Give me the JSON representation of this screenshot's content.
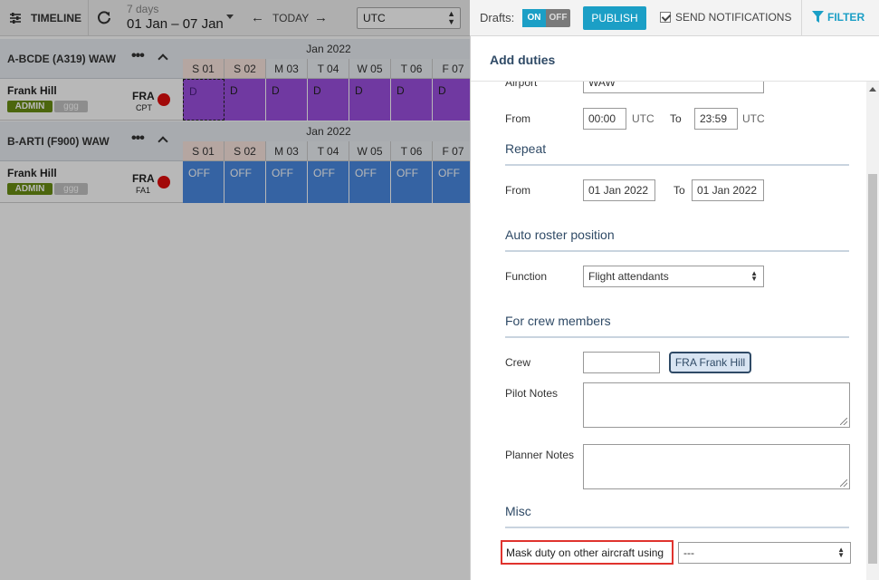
{
  "topbar": {
    "timeline_label": "TIMELINE",
    "range_small": "7 days",
    "range_big": "01 Jan – 07 Jan",
    "today_label": "TODAY",
    "timezone": "UTC",
    "drafts_label": "Drafts:",
    "toggle_on": "ON",
    "toggle_off": "OFF",
    "publish_label": "PUBLISH",
    "notify_label": "SEND NOTIFICATIONS",
    "filter_label": "FILTER"
  },
  "timeline": {
    "month_label": "Jan 2022",
    "days": [
      "S 01",
      "S 02",
      "M 03",
      "T 04",
      "W 05",
      "T 06",
      "F 07"
    ],
    "aircraft": [
      {
        "name": "A-BCDE (A319) WAW",
        "crew_name": "Frank Hill",
        "role_badge": "ADMIN",
        "tag": "ggg",
        "base": "FRA",
        "position": "CPT",
        "duties": [
          "D",
          "D",
          "D",
          "D",
          "D",
          "D",
          "D"
        ]
      },
      {
        "name": "B-ARTI (F900) WAW",
        "crew_name": "Frank Hill",
        "role_badge": "ADMIN",
        "tag": "ggg",
        "base": "FRA",
        "position": "FA1",
        "duties": [
          "OFF",
          "OFF",
          "OFF",
          "OFF",
          "OFF",
          "OFF",
          "OFF"
        ]
      }
    ]
  },
  "panel": {
    "title": "Add duties",
    "airport_label": "Airport",
    "airport_value": "WAW",
    "time_from_label": "From",
    "time_from_value": "00:00",
    "time_to_label": "To",
    "time_to_value": "23:59",
    "tz_unit": "UTC",
    "repeat_title": "Repeat",
    "repeat_from_label": "From",
    "repeat_from_value": "01 Jan 2022",
    "repeat_to_label": "To",
    "repeat_to_value": "01 Jan 2022",
    "auto_roster_title": "Auto roster position",
    "function_label": "Function",
    "function_value": "Flight attendants",
    "crew_members_title": "For crew members",
    "crew_label": "Crew",
    "crew_input_value": "",
    "crew_chip": "FRA Frank Hill",
    "pilot_notes_label": "Pilot Notes",
    "planner_notes_label": "Planner Notes",
    "misc_title": "Misc",
    "mask_label": "Mask duty on other aircraft using",
    "mask_value": "---"
  },
  "colors": {
    "accent": "#1b9fc6",
    "duty_purple": "#9c4fe0",
    "duty_blue": "#4a8ae2",
    "highlight_red": "#e0332e",
    "section_title": "#2f4a66"
  }
}
